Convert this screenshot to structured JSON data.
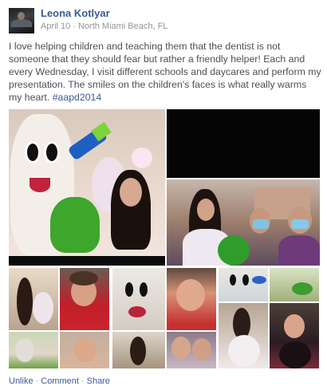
{
  "post": {
    "author": "Leona Kotlyar",
    "date": "April 10",
    "separator": "·",
    "location": "North Miami Beach, FL",
    "text": "I love helping children and teaching them that the dentist is not someone that they should fear but rather a friendly helper! Each and every Wednesday, I visit different schools and daycares and perform my presentation. The smiles on the children's faces is what really warms my heart.",
    "hashtag": "#aapd2014"
  },
  "actions": {
    "unlike": "Unlike",
    "comment": "Comment",
    "share": "Share",
    "separator": "·"
  },
  "colors": {
    "link": "#3b5998",
    "text": "#4b4f56",
    "meta": "#90949c"
  }
}
